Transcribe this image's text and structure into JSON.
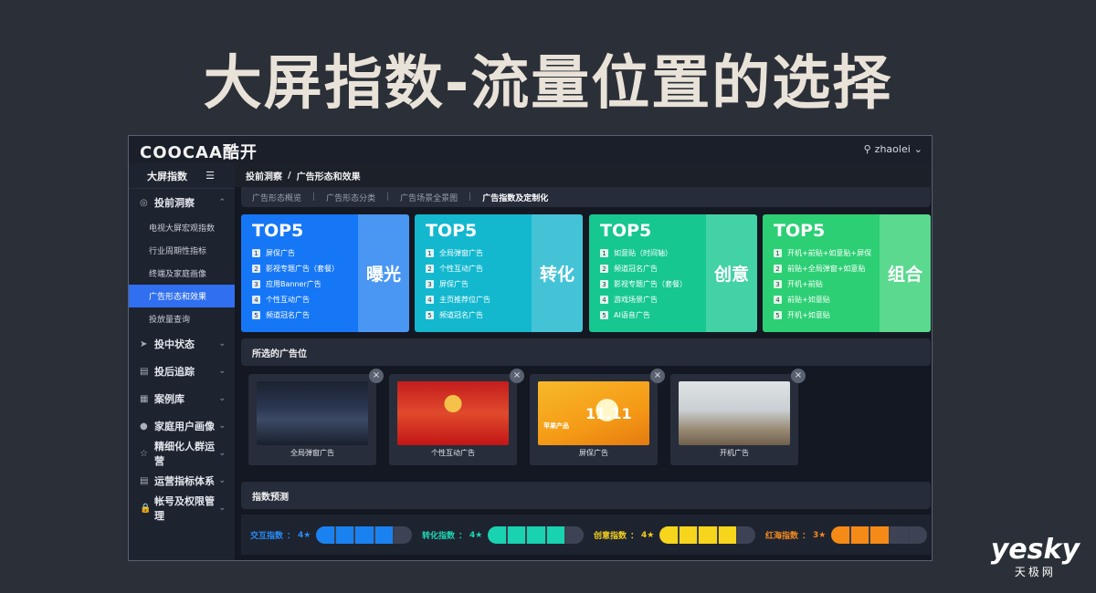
{
  "slide_title": "大屏指数-流量位置的选择",
  "app": {
    "logo": "COOCAA酷开",
    "user": "zhaolei",
    "user_icon": "user-icon"
  },
  "sidebar": {
    "title": "大屏指数",
    "menu_icon": "menu-collapse-icon",
    "groups": [
      {
        "label": "投前洞察",
        "icon": "eye-icon",
        "expanded": true,
        "items": [
          "电视大屏宏观指数",
          "行业周期性指标",
          "终端及家庭画像",
          "广告形态和效果",
          "投放量查询"
        ],
        "active_index": 3
      },
      {
        "label": "投中状态",
        "icon": "send-icon"
      },
      {
        "label": "投后追踪",
        "icon": "file-icon"
      },
      {
        "label": "案例库",
        "icon": "doc-icon"
      },
      {
        "label": "家庭用户画像",
        "icon": "person-icon"
      },
      {
        "label": "精细化人群运营",
        "icon": "star-icon"
      },
      {
        "label": "运营指标体系",
        "icon": "list-icon"
      },
      {
        "label": "帐号及权限管理",
        "icon": "lock-icon"
      }
    ]
  },
  "breadcrumb": {
    "parent": "投前洞察",
    "sep": "/",
    "current": "广告形态和效果"
  },
  "subtabs": [
    "广告形态概览",
    "广告形态分类",
    "广告场景全景图",
    "广告指数及定制化"
  ],
  "subtabs_active": 3,
  "cards": [
    {
      "top": "TOP5",
      "label": "曝光",
      "color_left": "#1677f6",
      "color_right": "#4a96f3",
      "items": [
        "屏保广告",
        "影视专题广告（套餐）",
        "应用Banner广告",
        "个性互动广告",
        "频道冠名广告"
      ]
    },
    {
      "top": "TOP5",
      "label": "转化",
      "color_left": "#13b8cf",
      "color_right": "#44c3d6",
      "items": [
        "全局弹窗广告",
        "个性互动广告",
        "屏保广告",
        "主页推荐位广告",
        "频道冠名广告"
      ]
    },
    {
      "top": "TOP5",
      "label": "创意",
      "color_left": "#16c790",
      "color_right": "#43d2a5",
      "items": [
        "如意贴（时间轴）",
        "频道冠名广告",
        "影视专题广告（套餐）",
        "游戏场景广告",
        "AI语音广告"
      ]
    },
    {
      "top": "TOP5",
      "label": "组合",
      "color_left": "#2dcf74",
      "color_right": "#5ad98f",
      "items": [
        "开机+前贴+如意贴+屏保",
        "前贴+全局弹窗+如意贴",
        "开机+前贴",
        "前贴+如意贴",
        "开机+如意贴"
      ]
    }
  ],
  "selected_section_title": "所选的广告位",
  "selected": [
    {
      "caption": "全局弹窗广告",
      "thumb": "car-ad-thumbnail"
    },
    {
      "caption": "个性互动广告",
      "thumb": "interactive-ad-thumbnail"
    },
    {
      "caption": "屏保广告",
      "thumb": "screensaver-ad-thumbnail",
      "badge": "11.11",
      "brand": "苹果产品"
    },
    {
      "caption": "开机广告",
      "thumb": "boot-ad-thumbnail"
    }
  ],
  "remove_symbol": "×",
  "index_section_title": "指数预测",
  "indices": [
    {
      "label": "交互指数",
      "stars": "4★",
      "value": 4,
      "max": 5,
      "color": "#1a82f0",
      "label_color": "#2b8cf5"
    },
    {
      "label": "转化指数",
      "stars": "4★",
      "value": 4,
      "max": 5,
      "color": "#19d3b0",
      "label_color": "#1fd6b3"
    },
    {
      "label": "创意指数",
      "stars": "4★",
      "value": 4,
      "max": 5,
      "color": "#f7d51c",
      "label_color": "#f2cf1e"
    },
    {
      "label": "红海指数",
      "stars": "3★",
      "value": 3,
      "max": 5,
      "color": "#f58a16",
      "label_color": "#f28a1e"
    }
  ],
  "watermark": {
    "line1": "yesky",
    "line2": "天极网"
  }
}
